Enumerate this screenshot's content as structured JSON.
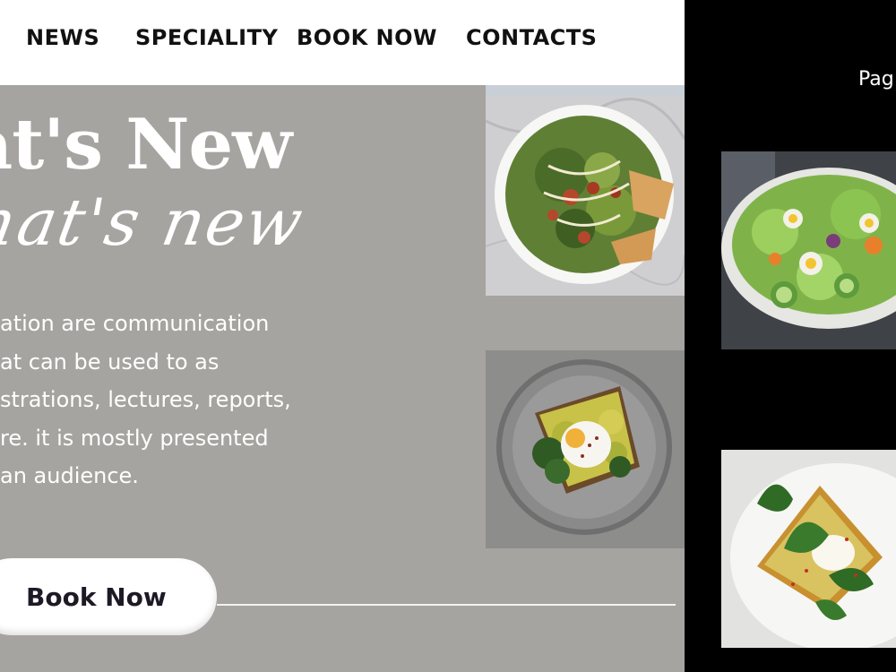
{
  "nav": {
    "items": [
      {
        "label": "NEWS"
      },
      {
        "label": "SPECIALITY"
      },
      {
        "label": "BOOK NOW"
      },
      {
        "label": "CONTACTS"
      }
    ]
  },
  "hero": {
    "title": "hat's New",
    "script_title": "hat's new",
    "paragraph_lines": [
      "ation are communication",
      "at can be used to as",
      "strations, lectures, reports,",
      "re. it is mostly presented",
      "an audience."
    ],
    "book_button": "Book Now"
  },
  "sidebar": {
    "page_label": "Pag"
  },
  "photos": {
    "caesar_salad": "caesar-salad-photo",
    "avocado_toast_egg": "avocado-toast-egg-photo",
    "garden_salad": "garden-salad-photo",
    "spinach_toast": "spinach-toast-photo"
  },
  "colors": {
    "panel_gray": "#a5a4a0",
    "nav_white": "#ffffff",
    "sidebar_black": "#000000",
    "button_text": "#1d1a26"
  }
}
